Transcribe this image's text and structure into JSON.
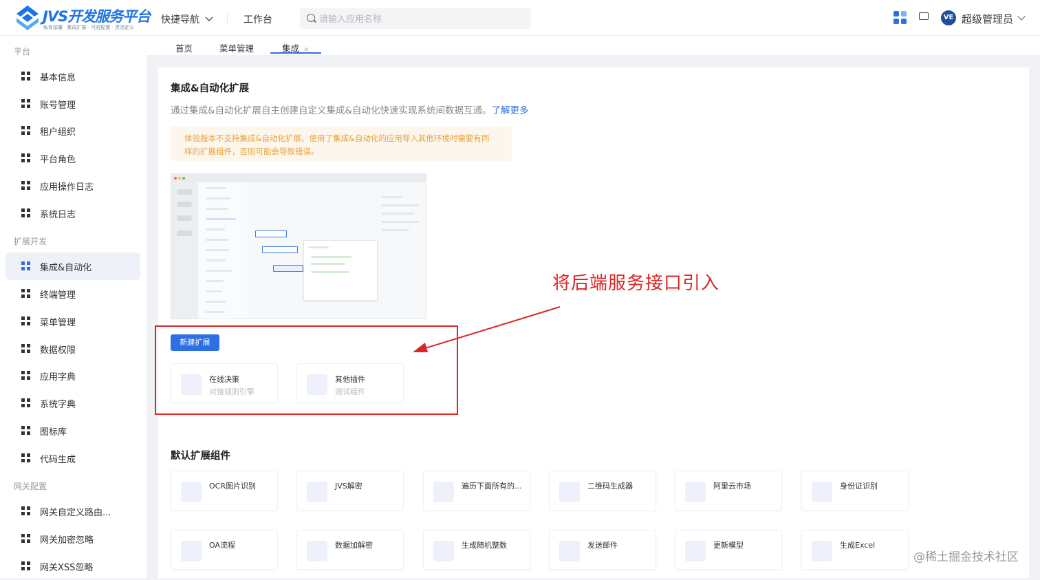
{
  "header": {
    "logo_title": "JVS开发服务平台",
    "logo_subtitle": "私有部署 · 集成扩展 · 可视配置 · 灵活定义",
    "quick_nav": "快捷导航",
    "workbench": "工作台",
    "search_placeholder": "请输入应用名称",
    "avatar_text": "VE",
    "user_name": "超级管理员"
  },
  "sidebar": {
    "groups": [
      "平台",
      "扩展开发",
      "网关配置"
    ],
    "items": [
      {
        "label": "基本信息"
      },
      {
        "label": "账号管理"
      },
      {
        "label": "租户组织"
      },
      {
        "label": "平台角色"
      },
      {
        "label": "应用操作日志"
      },
      {
        "label": "系统日志"
      },
      {
        "label": "集成&自动化",
        "active": true
      },
      {
        "label": "终端管理"
      },
      {
        "label": "菜单管理"
      },
      {
        "label": "数据权限"
      },
      {
        "label": "应用字典"
      },
      {
        "label": "系统字典"
      },
      {
        "label": "图标库"
      },
      {
        "label": "代码生成"
      },
      {
        "label": "网关自定义路由..."
      },
      {
        "label": "网关加密忽略"
      },
      {
        "label": "网关XSS忽略"
      }
    ]
  },
  "tabs": [
    {
      "label": "首页"
    },
    {
      "label": "菜单管理"
    },
    {
      "label": "集成",
      "active": true,
      "close": "×"
    }
  ],
  "main": {
    "title": "集成&自动化扩展",
    "description": "通过集成&自动化扩展自主创建自定义集成&自动化快速实现系统间数据互通。",
    "learn_more": "了解更多",
    "warning_line1": "体验版本不支持集成&自动化扩展、使用了集成&自动化的应用导入其他环境时需要有同",
    "warning_line2": "样的扩展组件，否则可能会导致错误。",
    "new_button": "新建扩展",
    "plugins": [
      {
        "title": "在线决策",
        "subtitle": "对接规则引擎"
      },
      {
        "title": "其他插件",
        "subtitle": "测试组件"
      }
    ],
    "default_section_title": "默认扩展组件",
    "default_components": [
      "OCR图片识别",
      "JVS解密",
      "遍历下面所有的...",
      "二维码生成器",
      "阿里云市场",
      "身份证识别",
      "OA流程",
      "数据加解密",
      "生成随机整数",
      "发送邮件",
      "更新模型",
      "生成Excel"
    ]
  },
  "annotation": {
    "text": "将后端服务接口引入",
    "color": "#e02424"
  },
  "watermark": "@稀土掘金技术社区",
  "colors": {
    "accent": "#2f6fe6",
    "warning_bg": "#fdf6ec",
    "warning_text": "#e6a23c"
  }
}
